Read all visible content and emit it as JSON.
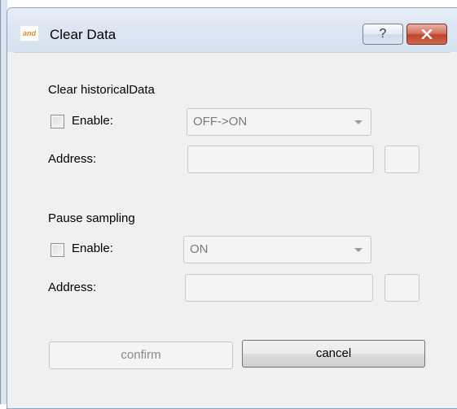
{
  "window": {
    "title": "Clear Data",
    "icon_name": "app-logo-icon",
    "help_label": "?",
    "close_label": "✕"
  },
  "clear_historical": {
    "heading": "Clear historicalData",
    "enable_label": "Enable:",
    "enable_checked": false,
    "trigger_value": "OFF->ON",
    "address_label": "Address:",
    "address_value": ""
  },
  "pause_sampling": {
    "heading": "Pause sampling",
    "enable_label": "Enable:",
    "enable_checked": false,
    "trigger_value": "ON",
    "address_label": "Address:",
    "address_value": ""
  },
  "buttons": {
    "confirm_label": "confirm",
    "cancel_label": "cancel"
  },
  "colors": {
    "close_button": "#c0432b",
    "titlebar": "#dde7f2",
    "dialog_background": "#f0f0f0"
  }
}
